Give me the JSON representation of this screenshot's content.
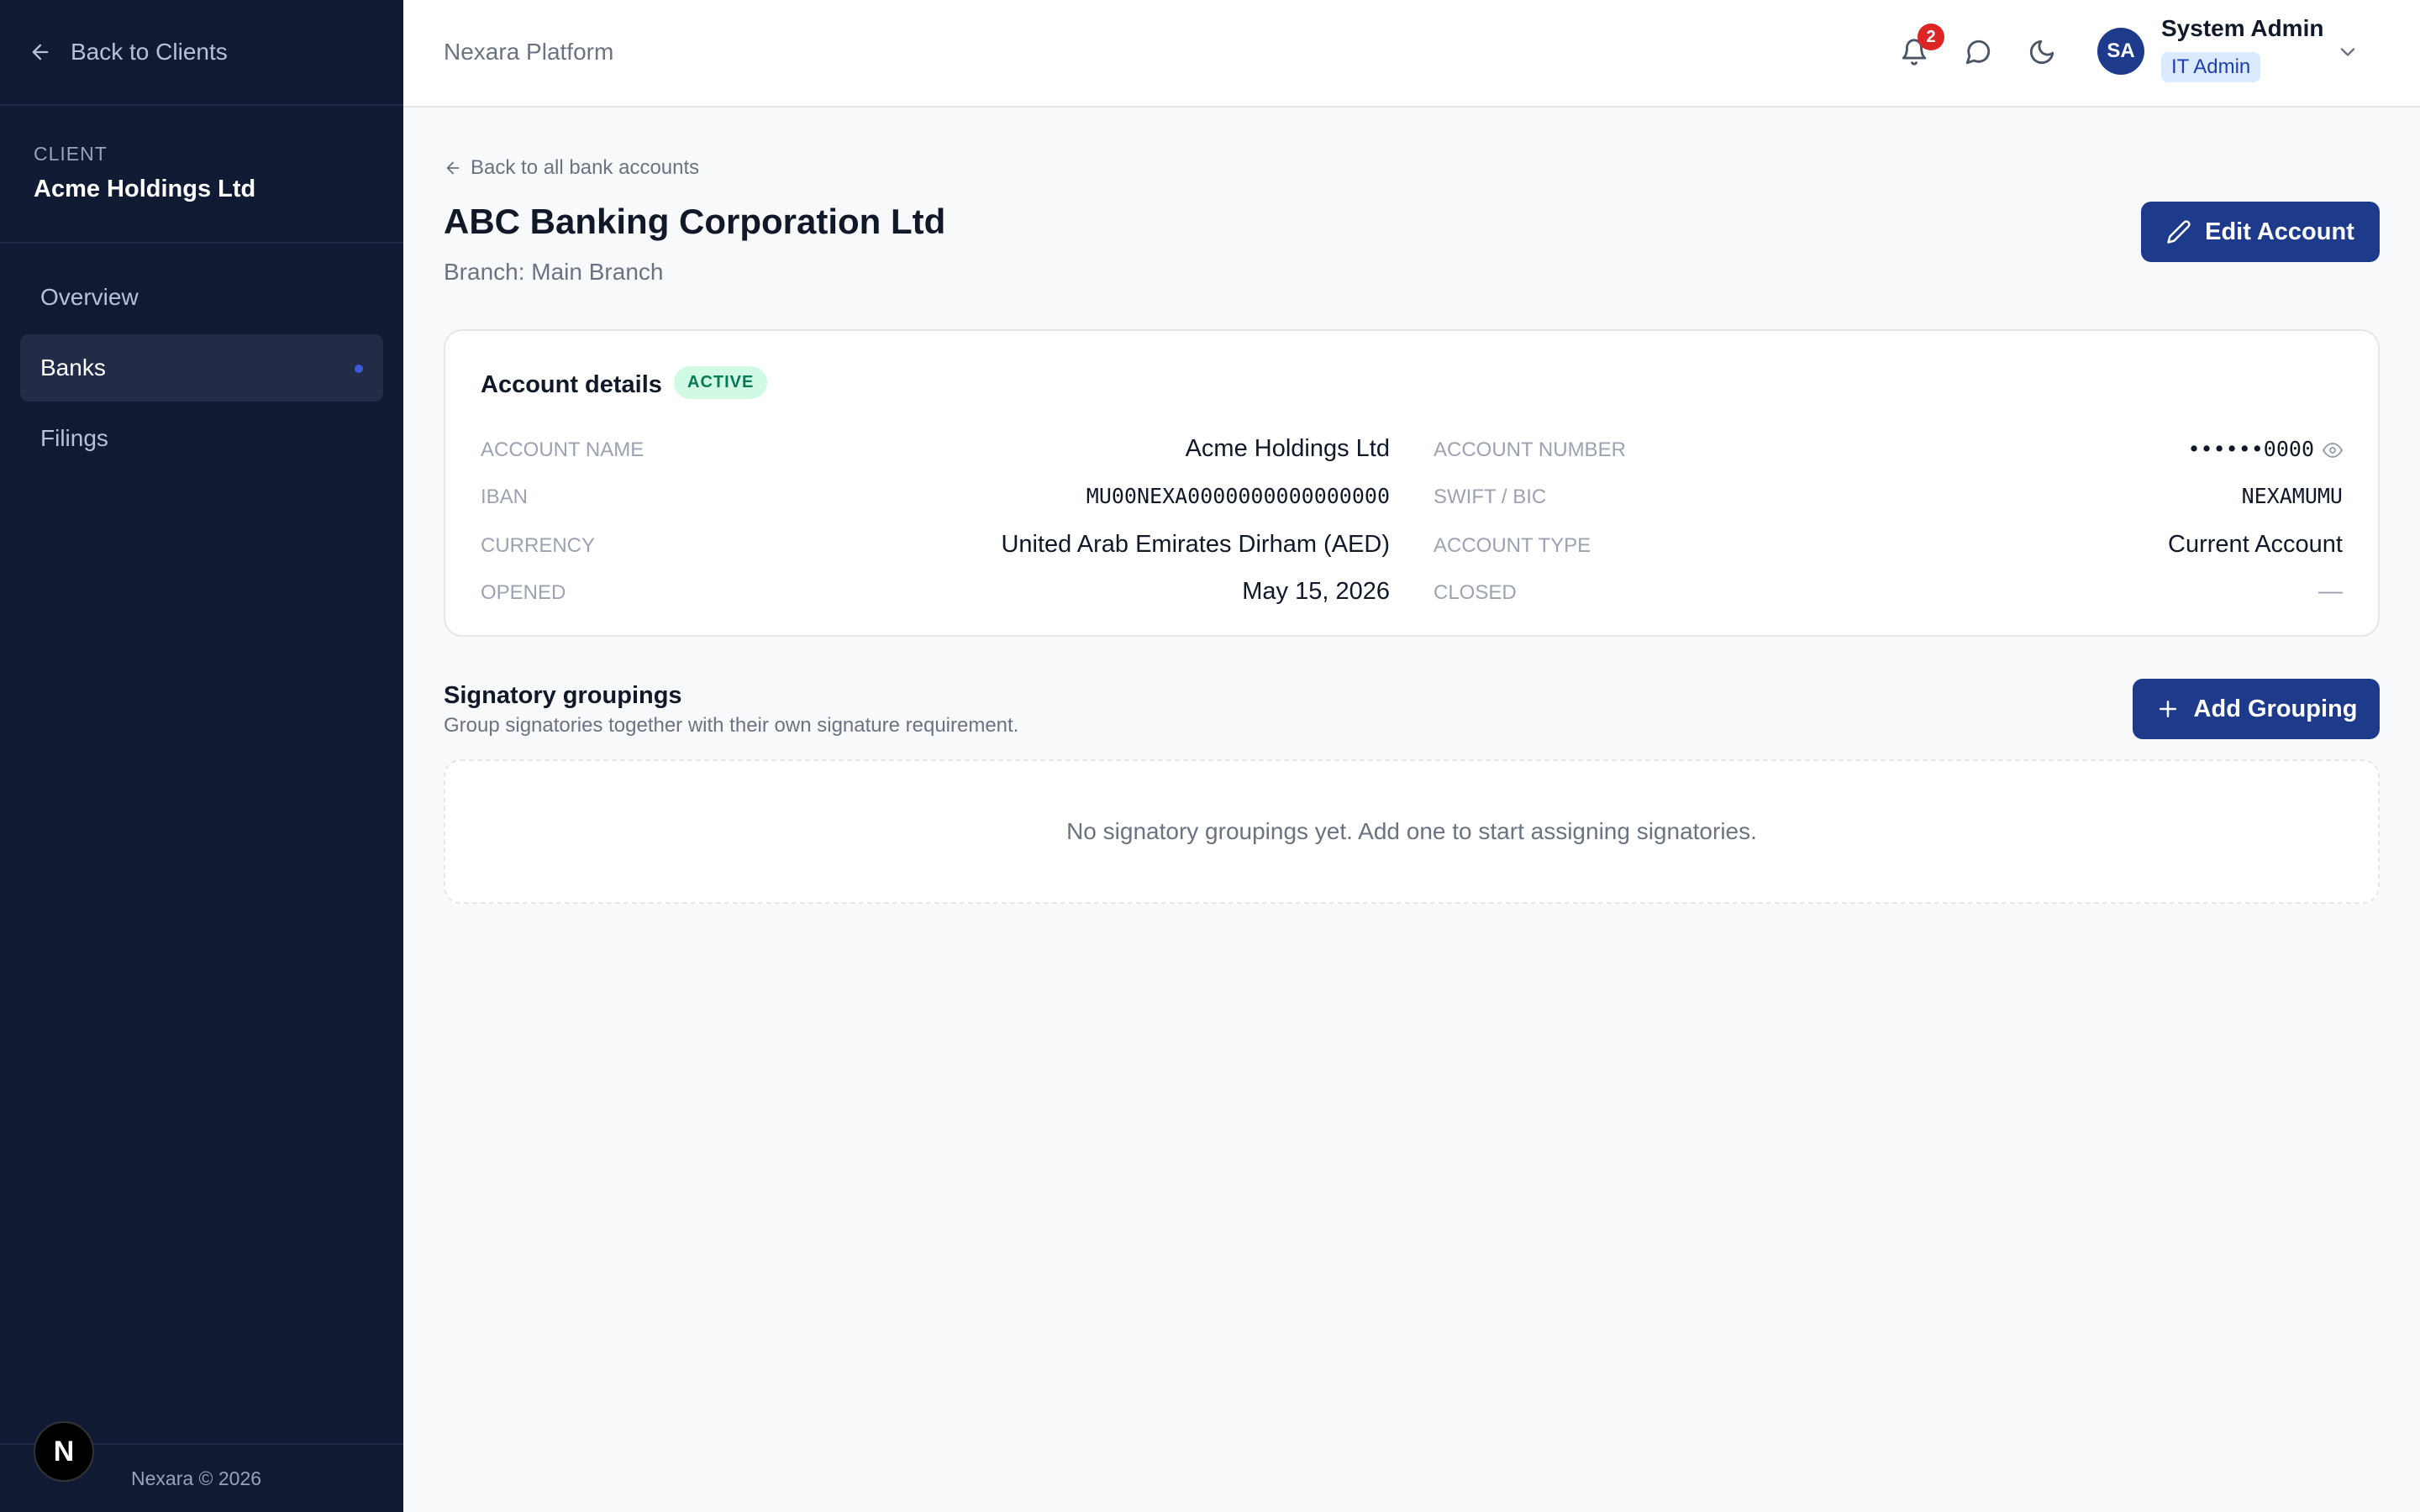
{
  "sidebar": {
    "back_label": "Back to Clients",
    "client_label": "CLIENT",
    "client_name": "Acme Holdings Ltd",
    "nav": [
      {
        "label": "Overview"
      },
      {
        "label": "Banks"
      },
      {
        "label": "Filings"
      }
    ],
    "footer": "Nexara © 2026",
    "logo_letter": "N"
  },
  "header": {
    "brand": "Nexara Platform",
    "notification_count": "2",
    "user_initials": "SA",
    "user_name": "System Admin",
    "user_role": "IT Admin"
  },
  "page": {
    "back_link": "Back to all bank accounts",
    "title": "ABC Banking Corporation Ltd",
    "subtitle": "Branch: Main Branch",
    "edit_label": "Edit Account"
  },
  "account": {
    "title": "Account details",
    "status": "ACTIVE",
    "fields": [
      {
        "label": "ACCOUNT NAME",
        "value": "Acme Holdings Ltd"
      },
      {
        "label": "ACCOUNT NUMBER",
        "value": "••••••0000"
      },
      {
        "label": "IBAN",
        "value": "MU00NEXA0000000000000000"
      },
      {
        "label": "SWIFT / BIC",
        "value": "NEXAMUMU"
      },
      {
        "label": "CURRENCY",
        "value": "United Arab Emirates Dirham (AED)"
      },
      {
        "label": "ACCOUNT TYPE",
        "value": "Current Account"
      },
      {
        "label": "OPENED",
        "value": "May 15, 2026"
      },
      {
        "label": "CLOSED",
        "value": "—"
      }
    ]
  },
  "signatory": {
    "title": "Signatory groupings",
    "subtitle": "Group signatories together with their own signature requirement.",
    "add_label": "Add Grouping",
    "empty_text": "No signatory groupings yet. Add one to start assigning signatories."
  },
  "colors": {
    "sidebar_bg": "#111a33",
    "primary": "#1e3a8a",
    "active_badge_bg": "#d1fae5",
    "active_badge_text": "#047857",
    "notification_badge": "#dc2626"
  }
}
